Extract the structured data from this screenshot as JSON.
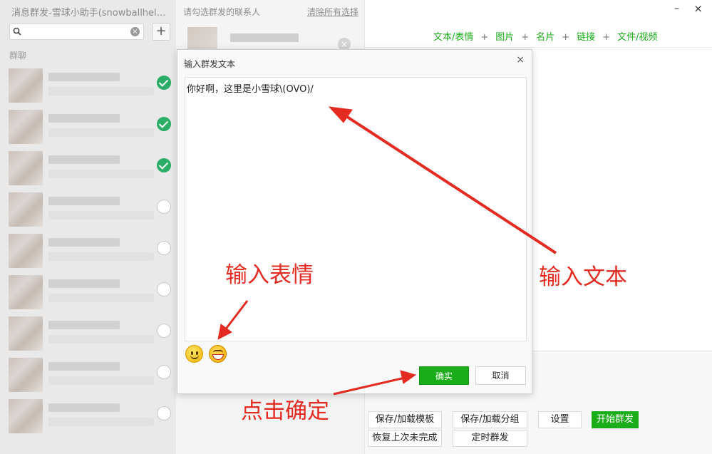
{
  "app": {
    "title": "消息群发-雪球小助手(snowballhel…",
    "window_controls": {
      "minimize": "–",
      "close": "×"
    }
  },
  "left": {
    "search": {
      "value": "",
      "placeholder": "",
      "clear": "×"
    },
    "add_label": "+",
    "section_label": "群聊",
    "rows": [
      {
        "checked": true
      },
      {
        "checked": true
      },
      {
        "checked": true
      },
      {
        "checked": false
      },
      {
        "checked": false
      },
      {
        "checked": false
      },
      {
        "checked": false
      },
      {
        "checked": false
      },
      {
        "checked": false
      }
    ]
  },
  "middle": {
    "hint": "请勾选群发的联系人",
    "clear_all": "清除所有选择",
    "remove": "×"
  },
  "right": {
    "toolbar": {
      "items": [
        "文本/表情",
        "图片",
        "名片",
        "链接",
        "文件/视频"
      ],
      "separator": "+"
    },
    "buttons": {
      "save_template": "保存/加载模板",
      "save_group": "保存/加载分组",
      "settings": "设置",
      "start": "开始群发",
      "restore": "恢复上次未完成",
      "schedule": "定时群发"
    }
  },
  "dialog": {
    "title": "输入群发文本",
    "close": "×",
    "text": "你好啊，这里是小雪球\\(OVO)/",
    "emoji": [
      "smile-icon",
      "grin-icon"
    ],
    "ok": "确实",
    "cancel": "取消"
  },
  "annotations": {
    "input_text": "输入文本",
    "input_emoji": "输入表情",
    "click_confirm": "点击确定",
    "color": "#e42b21"
  }
}
